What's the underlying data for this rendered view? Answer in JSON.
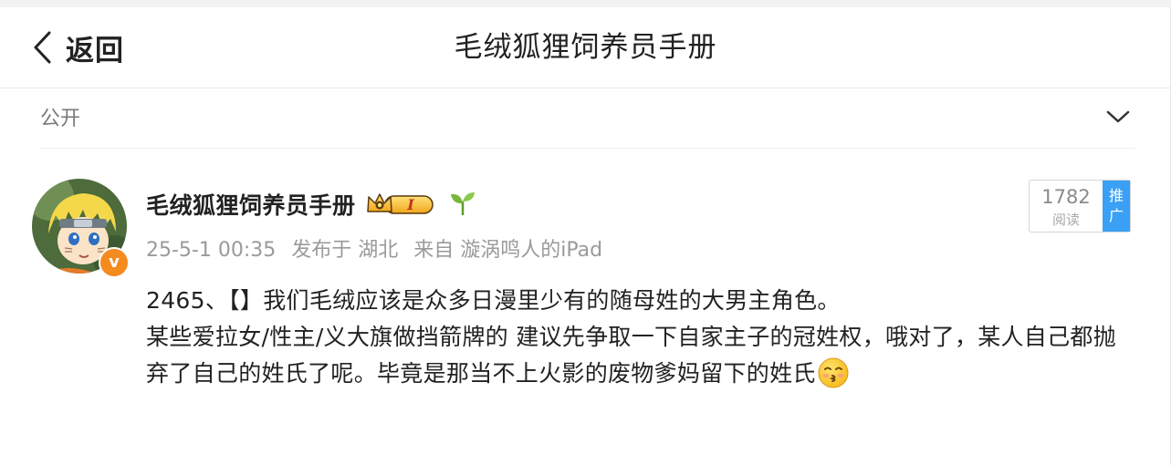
{
  "navbar": {
    "back_label": "返回",
    "title": "毛绒狐狸饲养员手册"
  },
  "visibility": {
    "label": "公开"
  },
  "post": {
    "username": "毛绒狐狸饲养员手册",
    "vip_level": "I",
    "verified_badge": "v",
    "meta": {
      "time": "25-5-1 00:35",
      "location": "发布于 湖北",
      "source": "来自 漩涡鸣人的iPad"
    },
    "reads": {
      "count": "1782",
      "label": "阅读",
      "promote": "推广"
    },
    "content": {
      "line1": "2465、【】我们毛绒应该是众多日漫里少有的随母姓的大男主角色。",
      "line2": "某些爱拉女/性主/义大旗做挡箭牌的 建议先争取一下自家主子的冠姓权，哦对了，某人自己都抛弃了自己的姓氏了呢。毕竟是那当不上火影的废物爹妈留下的姓氏"
    },
    "icons": [
      "chevron-left-icon",
      "chevron-down-icon",
      "crown-vip-icon",
      "sprout-icon",
      "kissing-face-emoji"
    ]
  }
}
